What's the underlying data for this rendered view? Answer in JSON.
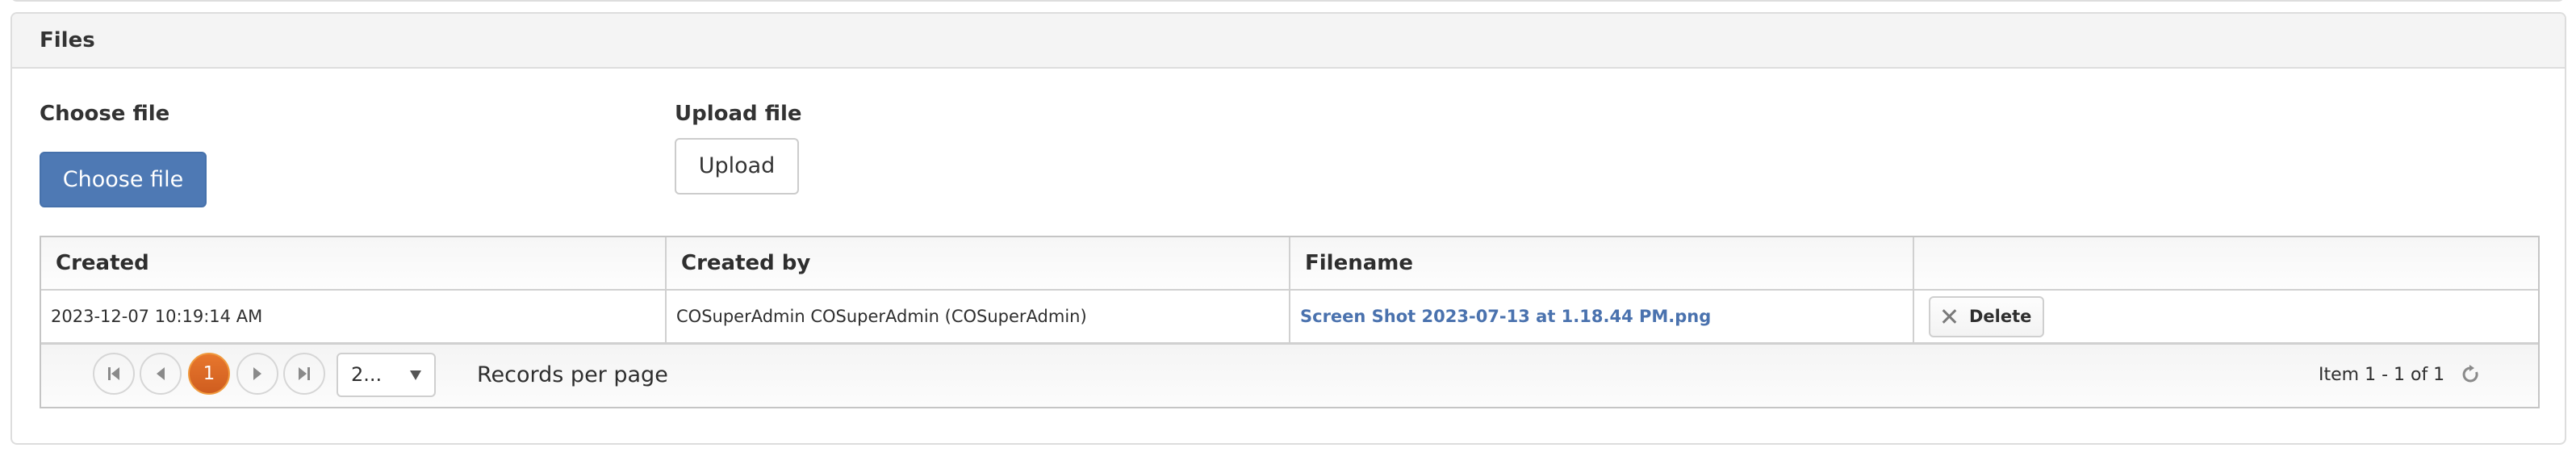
{
  "panel": {
    "title": "Files"
  },
  "upload_form": {
    "choose_label": "Choose file",
    "choose_button": "Choose file",
    "upload_label": "Upload file",
    "upload_button": "Upload"
  },
  "grid": {
    "columns": [
      "Created",
      "Created by",
      "Filename",
      ""
    ],
    "rows": [
      {
        "created": "2023-12-07 10:19:14 AM",
        "created_by": "COSuperAdmin COSuperAdmin (COSuperAdmin)",
        "filename": "Screen Shot 2023-07-13 at 1.18.44 PM.png",
        "delete_label": "Delete",
        "delete_icon": "close-icon"
      }
    ],
    "pager": {
      "first_icon": "first-page-icon",
      "prev_icon": "prev-page-icon",
      "current_page": "1",
      "next_icon": "next-page-icon",
      "last_icon": "last-page-icon",
      "page_size_value": "2...",
      "page_size_label": "Records per page",
      "info": "Item 1 - 1 of 1",
      "refresh_icon": "refresh-icon"
    }
  },
  "colors": {
    "primary_button": "#4e79b4",
    "link": "#4a72ae",
    "active_page": "#e06a25"
  }
}
